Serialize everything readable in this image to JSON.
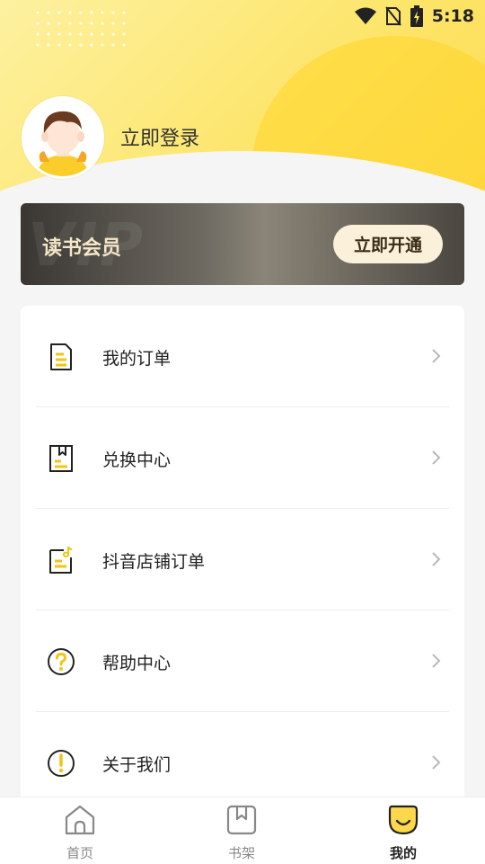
{
  "status_bar": {
    "time": "5:18"
  },
  "profile": {
    "login_label": "立即登录"
  },
  "vip": {
    "watermark": "VIP",
    "title": "读书会员",
    "button_label": "立即开通"
  },
  "menu": {
    "items": [
      {
        "label": "我的订单",
        "icon": "order-document-icon"
      },
      {
        "label": "兑换中心",
        "icon": "redeem-book-icon"
      },
      {
        "label": "抖音店铺订单",
        "icon": "douyin-order-icon"
      },
      {
        "label": "帮助中心",
        "icon": "help-question-icon"
      },
      {
        "label": "关于我们",
        "icon": "about-info-icon"
      }
    ]
  },
  "tabbar": {
    "tabs": [
      {
        "label": "首页",
        "icon": "home-icon"
      },
      {
        "label": "书架",
        "icon": "bookshelf-icon"
      },
      {
        "label": "我的",
        "icon": "profile-face-icon",
        "active": true
      }
    ]
  },
  "colors": {
    "accent": "#fcd84a",
    "vip_text": "#f4e6c8",
    "vip_button": "#fbf0d9"
  }
}
